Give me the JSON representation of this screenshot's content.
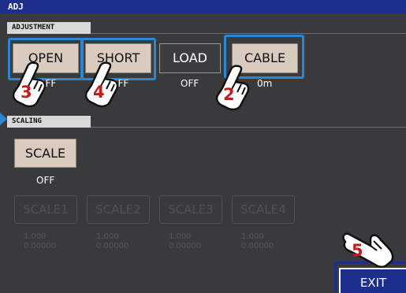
{
  "title": "ADJ",
  "adjustment": {
    "section_label": "ADJUSTMENT",
    "buttons": [
      {
        "label": "OPEN",
        "status": "OFF"
      },
      {
        "label": "SHORT",
        "status": "OFF"
      },
      {
        "label": "LOAD",
        "status": "OFF"
      },
      {
        "label": "CABLE",
        "status": "0m"
      }
    ]
  },
  "scaling": {
    "section_label": "SCALING",
    "scale_button": {
      "label": "SCALE",
      "status": "OFF"
    },
    "scales": [
      {
        "label": "SCALE1",
        "value_a": "1.000",
        "value_b": "0.00000"
      },
      {
        "label": "SCALE2",
        "value_a": "1.000",
        "value_b": "0.00000"
      },
      {
        "label": "SCALE3",
        "value_a": "1.000",
        "value_b": "0.00000"
      },
      {
        "label": "SCALE4",
        "value_a": "1.000",
        "value_b": "0.00000"
      }
    ]
  },
  "exit_label": "EXIT",
  "callouts": [
    "2",
    "3",
    "4",
    "5"
  ],
  "colors": {
    "title_bar": "#1d2f8c",
    "background": "#383a3c",
    "button_fill": "#d9cbbd",
    "highlight_border": "#2c86d6",
    "callout_number": "#c21d1d"
  },
  "icons": [
    "pointing-hand-icon",
    "arrow-pointer-icon"
  ]
}
